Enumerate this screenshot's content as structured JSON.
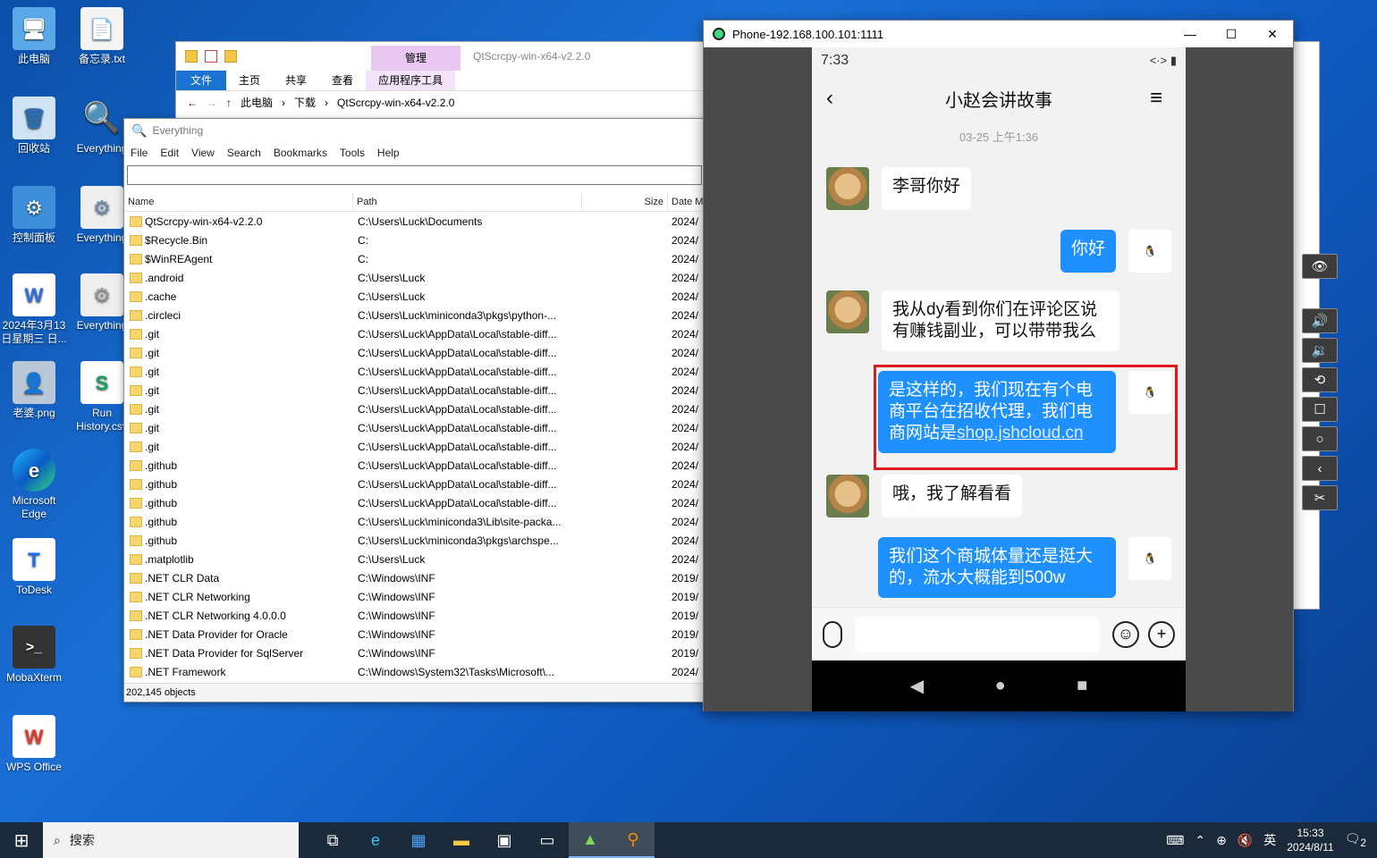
{
  "desktop": {
    "icons": [
      {
        "label": "此电脑",
        "glyph": "🖥"
      },
      {
        "label": "备忘录.txt",
        "glyph": "📄"
      },
      {
        "label": "回收站",
        "glyph": "🗑"
      },
      {
        "label": "Everything",
        "glyph": "🔍"
      },
      {
        "label": "控制面板",
        "glyph": "⚙"
      },
      {
        "label": "Everything",
        "glyph": "⚙"
      },
      {
        "label": "2024年3月13日星期三 日...",
        "glyph": "W"
      },
      {
        "label": "Everything",
        "glyph": "⚙"
      },
      {
        "label": "老婆.png",
        "glyph": "👤"
      },
      {
        "label": "Run History.csv",
        "glyph": "S"
      },
      {
        "label": "Microsoft Edge",
        "glyph": "e"
      },
      {
        "label": "ToDesk",
        "glyph": "T"
      },
      {
        "label": "MobaXterm",
        "glyph": ">_"
      },
      {
        "label": "WPS Office",
        "glyph": "W"
      }
    ]
  },
  "explorer": {
    "manage_tab": "管理",
    "title": "QtScrcpy-win-x64-v2.2.0",
    "ribbon": [
      "文件",
      "主页",
      "共享",
      "查看",
      "应用程序工具"
    ],
    "breadcrumb": [
      "此电脑",
      "下载",
      "QtScrcpy-win-x64-v2.2.0"
    ]
  },
  "everything": {
    "title": "Everything",
    "menu": [
      "File",
      "Edit",
      "View",
      "Search",
      "Bookmarks",
      "Tools",
      "Help"
    ],
    "columns": [
      "Name",
      "Path",
      "Size",
      "Date M"
    ],
    "rows": [
      {
        "name": "QtScrcpy-win-x64-v2.2.0",
        "path": "C:\\Users\\Luck\\Documents",
        "date": "2024/"
      },
      {
        "name": "$Recycle.Bin",
        "path": "C:",
        "date": "2024/"
      },
      {
        "name": "$WinREAgent",
        "path": "C:",
        "date": "2024/"
      },
      {
        "name": ".android",
        "path": "C:\\Users\\Luck",
        "date": "2024/"
      },
      {
        "name": ".cache",
        "path": "C:\\Users\\Luck",
        "date": "2024/"
      },
      {
        "name": ".circleci",
        "path": "C:\\Users\\Luck\\miniconda3\\pkgs\\python-...",
        "date": "2024/"
      },
      {
        "name": ".git",
        "path": "C:\\Users\\Luck\\AppData\\Local\\stable-diff...",
        "date": "2024/"
      },
      {
        "name": ".git",
        "path": "C:\\Users\\Luck\\AppData\\Local\\stable-diff...",
        "date": "2024/"
      },
      {
        "name": ".git",
        "path": "C:\\Users\\Luck\\AppData\\Local\\stable-diff...",
        "date": "2024/"
      },
      {
        "name": ".git",
        "path": "C:\\Users\\Luck\\AppData\\Local\\stable-diff...",
        "date": "2024/"
      },
      {
        "name": ".git",
        "path": "C:\\Users\\Luck\\AppData\\Local\\stable-diff...",
        "date": "2024/"
      },
      {
        "name": ".git",
        "path": "C:\\Users\\Luck\\AppData\\Local\\stable-diff...",
        "date": "2024/"
      },
      {
        "name": ".git",
        "path": "C:\\Users\\Luck\\AppData\\Local\\stable-diff...",
        "date": "2024/"
      },
      {
        "name": ".github",
        "path": "C:\\Users\\Luck\\AppData\\Local\\stable-diff...",
        "date": "2024/"
      },
      {
        "name": ".github",
        "path": "C:\\Users\\Luck\\AppData\\Local\\stable-diff...",
        "date": "2024/"
      },
      {
        "name": ".github",
        "path": "C:\\Users\\Luck\\AppData\\Local\\stable-diff...",
        "date": "2024/"
      },
      {
        "name": ".github",
        "path": "C:\\Users\\Luck\\miniconda3\\Lib\\site-packa...",
        "date": "2024/"
      },
      {
        "name": ".github",
        "path": "C:\\Users\\Luck\\miniconda3\\pkgs\\archspe...",
        "date": "2024/"
      },
      {
        "name": ".matplotlib",
        "path": "C:\\Users\\Luck",
        "date": "2024/"
      },
      {
        "name": ".NET CLR Data",
        "path": "C:\\Windows\\INF",
        "date": "2019/"
      },
      {
        "name": ".NET CLR Networking",
        "path": "C:\\Windows\\INF",
        "date": "2019/"
      },
      {
        "name": ".NET CLR Networking 4.0.0.0",
        "path": "C:\\Windows\\INF",
        "date": "2019/"
      },
      {
        "name": ".NET Data Provider for Oracle",
        "path": "C:\\Windows\\INF",
        "date": "2019/"
      },
      {
        "name": ".NET Data Provider for SqlServer",
        "path": "C:\\Windows\\INF",
        "date": "2019/"
      },
      {
        "name": ".NET Framework",
        "path": "C:\\Windows\\System32\\Tasks\\Microsoft\\...",
        "date": "2024/"
      }
    ],
    "status": "202,145 objects"
  },
  "phone": {
    "window_title": "Phone-192.168.100.101:1111",
    "status_time": "7:33",
    "status_icons": "<·> ▮",
    "chat_title": "小赵会讲故事",
    "timestamp": "03-25 上午1:36",
    "messages": [
      {
        "side": "left",
        "text": "李哥你好"
      },
      {
        "side": "right",
        "text": "你好"
      },
      {
        "side": "left",
        "text": "我从dy看到你们在评论区说有赚钱副业，可以带带我么"
      },
      {
        "side": "right",
        "text": "是这样的，我们现在有个电商平台在招收代理，我们电商网站是",
        "link": "shop.jshcloud.cn"
      },
      {
        "side": "left",
        "text": "哦，我了解看看"
      },
      {
        "side": "right",
        "text": "我们这个商城体量还是挺大的，流水大概能到500w"
      }
    ]
  },
  "taskbar": {
    "search_placeholder": "搜索",
    "ime": "英",
    "time": "15:33",
    "date": "2024/8/11",
    "notifications": "2"
  }
}
